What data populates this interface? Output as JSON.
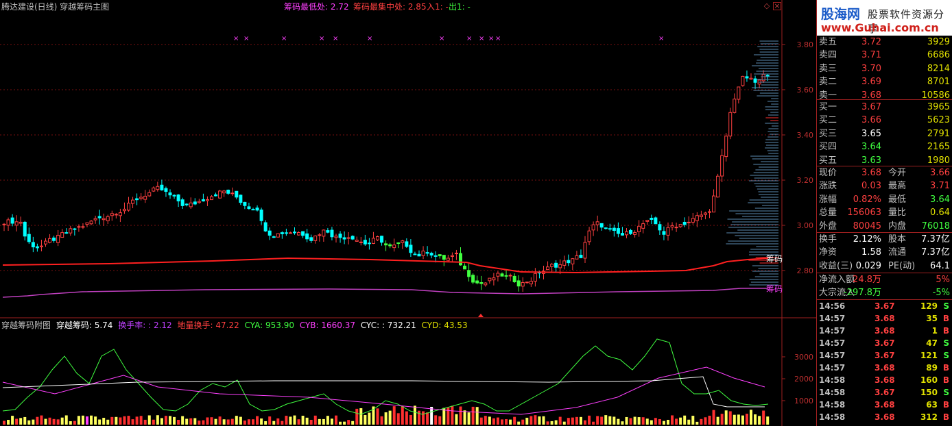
{
  "header": {
    "title": "腾达建设(日线) 穿越筹码主图",
    "info1": "筹码最低处: 2.72",
    "info2": "筹码最集中处: 2.85",
    "info3": "入1: -",
    "info4": "出1: -"
  },
  "sub_header": {
    "title": "穿越筹码附图",
    "v1": "穿越筹码: 5.74",
    "v2": "换手率: : 2.12",
    "v3": "地量换手: 47.22",
    "v4": "CYA: 953.90",
    "v5": "CYB: 1660.37",
    "v6": "CYC: : 732.21",
    "v7": "CYD: 43.53"
  },
  "axis": {
    "main_ticks": [
      "3.80",
      "3.60",
      "3.40",
      "3.20",
      "3.00",
      "2.80"
    ],
    "sub_ticks": [
      "3000",
      "2000",
      "1000"
    ],
    "chip_label": "筹码"
  },
  "logo": {
    "brand": "股海网",
    "slogan": "股票软件资源分享",
    "url": "www.Guhai.com.cn"
  },
  "order_book": {
    "asks": [
      {
        "label": "卖五",
        "price": "3.72",
        "vol": "3929"
      },
      {
        "label": "卖四",
        "price": "3.71",
        "vol": "6686"
      },
      {
        "label": "卖三",
        "price": "3.70",
        "vol": "8214"
      },
      {
        "label": "卖二",
        "price": "3.69",
        "vol": "8701"
      },
      {
        "label": "卖一",
        "price": "3.68",
        "vol": "10586"
      }
    ],
    "bids": [
      {
        "label": "买一",
        "price": "3.67",
        "vol": "3965"
      },
      {
        "label": "买二",
        "price": "3.66",
        "vol": "5623"
      },
      {
        "label": "买三",
        "price": "3.65",
        "vol": "2791"
      },
      {
        "label": "买四",
        "price": "3.64",
        "vol": "2165"
      },
      {
        "label": "买五",
        "price": "3.63",
        "vol": "1980"
      }
    ]
  },
  "quote": [
    {
      "l1": "现价",
      "v1": "3.68",
      "l2": "今开",
      "v2": "3.66"
    },
    {
      "l1": "涨跌",
      "v1": "0.03",
      "l2": "最高",
      "v2": "3.71"
    },
    {
      "l1": "涨幅",
      "v1": "0.82%",
      "l2": "最低",
      "v2": "3.64"
    },
    {
      "l1": "总量",
      "v1": "156063",
      "l2": "量比",
      "v2": "0.64"
    },
    {
      "l1": "外盘",
      "v1": "80045",
      "l2": "内盘",
      "v2": "76018"
    }
  ],
  "stats": [
    {
      "l1": "换手",
      "v1": "2.12%",
      "l2": "股本",
      "v2": "7.37亿"
    },
    {
      "l1": "净资",
      "v1": "1.58",
      "l2": "流通",
      "v2": "7.37亿"
    },
    {
      "l1": "收益(三)",
      "v1": "0.029",
      "l2": "PE(动)",
      "v2": "64.1"
    }
  ],
  "flow": [
    {
      "label": "净流入额",
      "value": "24.8万",
      "pct": "5%"
    },
    {
      "label": "大宗流入",
      "value": "-297.8万",
      "pct": "-5%"
    }
  ],
  "ticks": [
    {
      "t": "14:56",
      "p": "3.67",
      "v": "129",
      "s": "S"
    },
    {
      "t": "14:57",
      "p": "3.68",
      "v": "35",
      "s": "B"
    },
    {
      "t": "14:57",
      "p": "3.68",
      "v": "1",
      "s": "B"
    },
    {
      "t": "14:57",
      "p": "3.67",
      "v": "47",
      "s": "S"
    },
    {
      "t": "14:57",
      "p": "3.67",
      "v": "121",
      "s": "S"
    },
    {
      "t": "14:57",
      "p": "3.68",
      "v": "89",
      "s": "B"
    },
    {
      "t": "14:58",
      "p": "3.68",
      "v": "160",
      "s": "B"
    },
    {
      "t": "14:58",
      "p": "3.67",
      "v": "150",
      "s": "S"
    },
    {
      "t": "14:58",
      "p": "3.68",
      "v": "63",
      "s": "B"
    },
    {
      "t": "14:58",
      "p": "3.68",
      "v": "312",
      "s": "B"
    }
  ],
  "colors": {
    "up": "#ff4040",
    "down": "#00ffff",
    "green_candle": "#40ff40",
    "chip_red": "#ff2020",
    "chip_purple": "#c040c0",
    "magenta": "#ff40ff"
  }
}
